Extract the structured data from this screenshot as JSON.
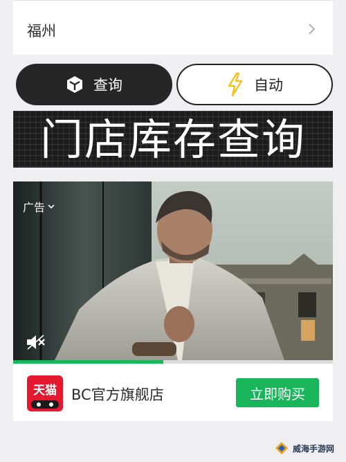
{
  "city_row": {
    "label": "福州"
  },
  "actions": {
    "query_label": "查询",
    "auto_label": "自动"
  },
  "banner": {
    "title": "门店库存查询"
  },
  "ad": {
    "tag_label": "广告",
    "progress": 0.47,
    "advertiser": "BC官方旗舰店",
    "logo_text": "天猫",
    "buy_label": "立即购买"
  },
  "watermark": {
    "text": "威海手游网"
  },
  "colors": {
    "accent_green": "#19b55a",
    "dark_pill": "#262626",
    "bolt_yellow": "#f2c21b",
    "tmall_red": "#e4182f"
  },
  "icons": [
    "chevron-right-icon",
    "cube-icon",
    "lightning-icon",
    "chevron-down-icon",
    "mute-icon",
    "tmall-cat-icon"
  ]
}
